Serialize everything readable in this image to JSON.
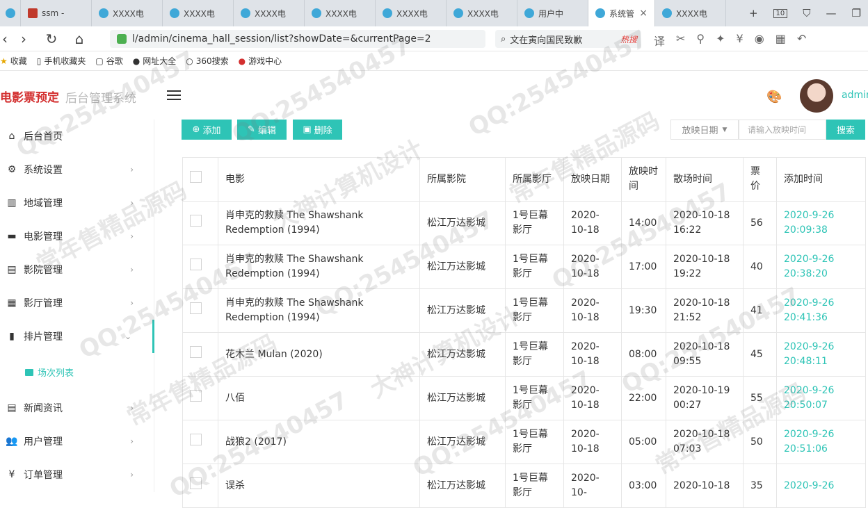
{
  "browser": {
    "tabs": [
      {
        "label": "ssm - "
      },
      {
        "label": "XXXX电"
      },
      {
        "label": "XXXX电"
      },
      {
        "label": "XXXX电"
      },
      {
        "label": "XXXX电"
      },
      {
        "label": "XXXX电"
      },
      {
        "label": "XXXX电"
      },
      {
        "label": "用户中"
      },
      {
        "label": "系统管"
      },
      {
        "label": "XXXX电"
      }
    ],
    "tab_count": "10",
    "url": "l/admin/cinema_hall_session/list?showDate=&currentPage=2",
    "search_text": "文在寅向国民致歉",
    "search_hot": "热搜",
    "bookmarks": [
      "收藏",
      "手机收藏夹",
      "谷歌",
      "网址大全",
      "360搜索",
      "游戏中心"
    ]
  },
  "app": {
    "brand": "电影票预定",
    "subtitle": "后台管理系统",
    "user": "admin"
  },
  "sidebar": {
    "items": [
      {
        "label": "后台首页",
        "icon": "home-icon"
      },
      {
        "label": "系统设置",
        "icon": "gear-icon"
      },
      {
        "label": "地域管理",
        "icon": "map-icon"
      },
      {
        "label": "电影管理",
        "icon": "film-icon"
      },
      {
        "label": "影院管理",
        "icon": "store-icon"
      },
      {
        "label": "影厅管理",
        "icon": "building-icon"
      },
      {
        "label": "排片管理",
        "icon": "calendar-icon"
      },
      {
        "label": "新闻资讯",
        "icon": "news-icon"
      },
      {
        "label": "用户管理",
        "icon": "users-icon"
      },
      {
        "label": "订单管理",
        "icon": "yen-icon"
      }
    ],
    "sub_item": "场次列表"
  },
  "toolbar": {
    "add": "添加",
    "edit": "编辑",
    "delete": "删除",
    "date_select": "放映日期",
    "date_placeholder": "请输入放映时间",
    "search": "搜索"
  },
  "table": {
    "headers": [
      "电影",
      "所属影院",
      "所属影厅",
      "放映日期",
      "放映时间",
      "散场时间",
      "票价",
      "添加时间"
    ],
    "rows": [
      {
        "movie": "肖申克的救赎 The Shawshank Redemption (1994)",
        "cinema": "松江万达影城",
        "hall": "1号巨幕影厅",
        "date": "2020-10-18",
        "time": "14:00",
        "end": "2020-10-18 16:22",
        "price": "56",
        "added": "2020-9-26 20:09:38"
      },
      {
        "movie": "肖申克的救赎 The Shawshank Redemption (1994)",
        "cinema": "松江万达影城",
        "hall": "1号巨幕影厅",
        "date": "2020-10-18",
        "time": "17:00",
        "end": "2020-10-18 19:22",
        "price": "40",
        "added": "2020-9-26 20:38:20"
      },
      {
        "movie": "肖申克的救赎 The Shawshank Redemption (1994)",
        "cinema": "松江万达影城",
        "hall": "1号巨幕影厅",
        "date": "2020-10-18",
        "time": "19:30",
        "end": "2020-10-18 21:52",
        "price": "41",
        "added": "2020-9-26 20:41:36"
      },
      {
        "movie": "花木兰 Mulan (2020)",
        "cinema": "松江万达影城",
        "hall": "1号巨幕影厅",
        "date": "2020-10-18",
        "time": "08:00",
        "end": "2020-10-18 09:55",
        "price": "45",
        "added": "2020-9-26 20:48:11"
      },
      {
        "movie": "八佰",
        "cinema": "松江万达影城",
        "hall": "1号巨幕影厅",
        "date": "2020-10-18",
        "time": "22:00",
        "end": "2020-10-19 00:27",
        "price": "55",
        "added": "2020-9-26 20:50:07"
      },
      {
        "movie": "战狼2 (2017)",
        "cinema": "松江万达影城",
        "hall": "1号巨幕影厅",
        "date": "2020-10-18",
        "time": "05:00",
        "end": "2020-10-18 07:03",
        "price": "50",
        "added": "2020-9-26 20:51:06"
      },
      {
        "movie": "误杀",
        "cinema": "松江万达影城",
        "hall": "1号巨幕影厅",
        "date": "2020-10-",
        "time": "03:00",
        "end": "2020-10-18",
        "price": "35",
        "added": "2020-9-26"
      }
    ]
  },
  "watermark": [
    "QQ:254540457",
    "常年售精品源码",
    "大神计算机设计"
  ]
}
